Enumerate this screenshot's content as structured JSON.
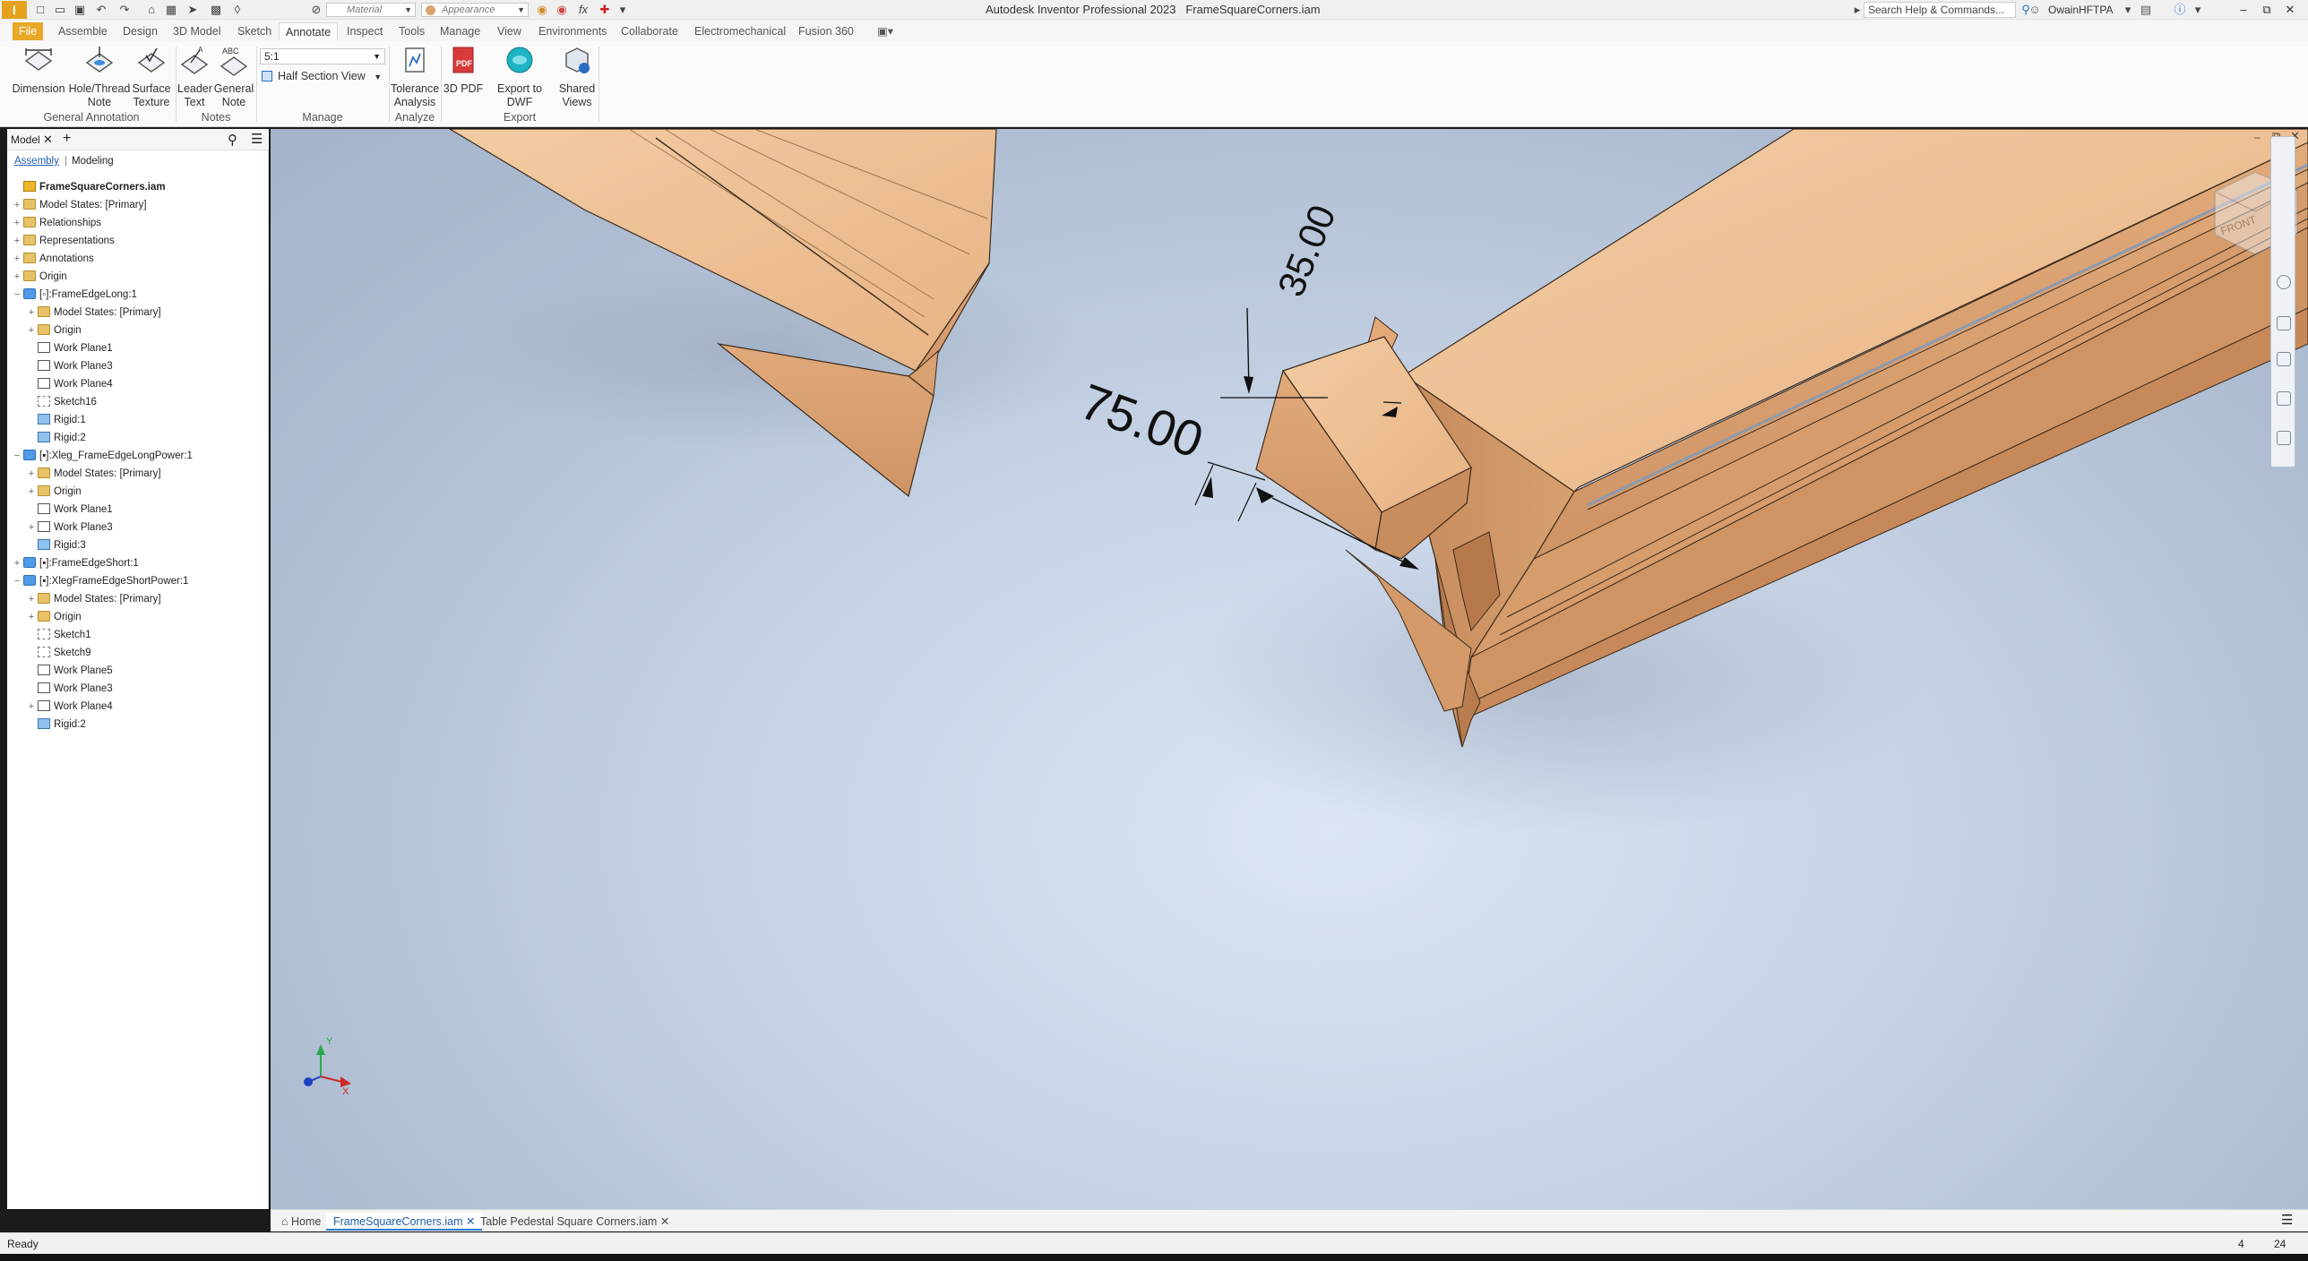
{
  "titlebar": {
    "app_title": "Autodesk Inventor Professional 2023",
    "document_title": "FrameSquareCorners.iam",
    "material_placeholder": "Material",
    "appearance_placeholder": "Appearance",
    "search_placeholder": "Search Help & Commands...",
    "user": "OwainHFTPA",
    "logo_letter": "I"
  },
  "ribbon": {
    "tabs": [
      "File",
      "Assemble",
      "Design",
      "3D Model",
      "Sketch",
      "Annotate",
      "Inspect",
      "Tools",
      "Manage",
      "View",
      "Environments",
      "Collaborate",
      "Electromechanical",
      "Fusion 360"
    ],
    "active_tab": "Annotate",
    "buttons": {
      "dimension": "Dimension",
      "hole_thread_note": "Hole/Thread\nNote",
      "surface_texture": "Surface\nTexture",
      "leader_text": "Leader\nText",
      "general_note": "General\nNote",
      "tolerance_analysis": "Tolerance\nAnalysis",
      "pdf_3d": "3D PDF",
      "export_dwf": "Export to DWF",
      "shared_views": "Shared\nViews"
    },
    "scale_value": "5:1",
    "half_section": "Half Section View",
    "groups": {
      "general_annotation": "General Annotation",
      "notes": "Notes",
      "manage": "Manage",
      "analyze": "Analyze",
      "export": "Export"
    },
    "pdf_badge": "PDF",
    "abc_badge": "ABC"
  },
  "browser": {
    "tab_label": "Model",
    "subtab_assembly": "Assembly",
    "subtab_modeling": "Modeling",
    "tree": [
      {
        "label": "FrameSquareCorners.iam",
        "level": 0,
        "icon": "asm",
        "exp": "",
        "bold": true
      },
      {
        "label": "Model States: [Primary]",
        "level": 0,
        "icon": "folder",
        "exp": "+"
      },
      {
        "label": "Relationships",
        "level": 0,
        "icon": "folder",
        "exp": "+"
      },
      {
        "label": "Representations",
        "level": 0,
        "icon": "folder",
        "exp": "+"
      },
      {
        "label": "Annotations",
        "level": 0,
        "icon": "folder",
        "exp": "+"
      },
      {
        "label": "Origin",
        "level": 0,
        "icon": "folder",
        "exp": "+"
      },
      {
        "label": "[◦]:FrameEdgeLong:1",
        "level": 0,
        "icon": "part",
        "exp": "−"
      },
      {
        "label": "Model States: [Primary]",
        "level": 1,
        "icon": "folder",
        "exp": "+"
      },
      {
        "label": "Origin",
        "level": 1,
        "icon": "folder",
        "exp": "+"
      },
      {
        "label": "Work Plane1",
        "level": 1,
        "icon": "plane",
        "exp": ""
      },
      {
        "label": "Work Plane3",
        "level": 1,
        "icon": "plane",
        "exp": ""
      },
      {
        "label": "Work Plane4",
        "level": 1,
        "icon": "plane",
        "exp": ""
      },
      {
        "label": "Sketch16",
        "level": 1,
        "icon": "sketch",
        "exp": ""
      },
      {
        "label": "Rigid:1",
        "level": 1,
        "icon": "rigid",
        "exp": ""
      },
      {
        "label": "Rigid:2",
        "level": 1,
        "icon": "rigid",
        "exp": ""
      },
      {
        "label": "[▪]:Xleg_FrameEdgeLongPower:1",
        "level": 0,
        "icon": "part",
        "exp": "−"
      },
      {
        "label": "Model States: [Primary]",
        "level": 1,
        "icon": "folder",
        "exp": "+"
      },
      {
        "label": "Origin",
        "level": 1,
        "icon": "folder",
        "exp": "+"
      },
      {
        "label": "Work Plane1",
        "level": 1,
        "icon": "plane",
        "exp": ""
      },
      {
        "label": "Work Plane3",
        "level": 1,
        "icon": "plane",
        "exp": "+"
      },
      {
        "label": "Rigid:3",
        "level": 1,
        "icon": "rigid",
        "exp": ""
      },
      {
        "label": "[▪]:FrameEdgeShort:1",
        "level": 0,
        "icon": "part",
        "exp": "+"
      },
      {
        "label": "[▪]:XlegFrameEdgeShortPower:1",
        "level": 0,
        "icon": "part",
        "exp": "−"
      },
      {
        "label": "Model States: [Primary]",
        "level": 1,
        "icon": "folder",
        "exp": "+"
      },
      {
        "label": "Origin",
        "level": 1,
        "icon": "folder",
        "exp": "+"
      },
      {
        "label": "Sketch1",
        "level": 1,
        "icon": "sketch",
        "exp": ""
      },
      {
        "label": "Sketch9",
        "level": 1,
        "icon": "sketch",
        "exp": ""
      },
      {
        "label": "Work Plane5",
        "level": 1,
        "icon": "plane",
        "exp": ""
      },
      {
        "label": "Work Plane3",
        "level": 1,
        "icon": "plane",
        "exp": ""
      },
      {
        "label": "Work Plane4",
        "level": 1,
        "icon": "plane",
        "exp": "+"
      },
      {
        "label": "Rigid:2",
        "level": 1,
        "icon": "rigid",
        "exp": ""
      }
    ]
  },
  "viewport": {
    "dimension_1": "35.00",
    "dimension_2": "75.00",
    "viewcube_label": "FRONT",
    "triad": {
      "x": "X",
      "y": "Y"
    }
  },
  "doc_tabs": {
    "home": "Home",
    "tabs": [
      "FrameSquareCorners.iam",
      "Table Pedestal Square Corners.iam"
    ],
    "active": 0
  },
  "status": {
    "text": "Ready",
    "count1": "4",
    "count2": "24"
  },
  "colors": {
    "accent": "#e9a728",
    "wood": "#e8b888",
    "viewport_bg": "#c7d4e6"
  }
}
